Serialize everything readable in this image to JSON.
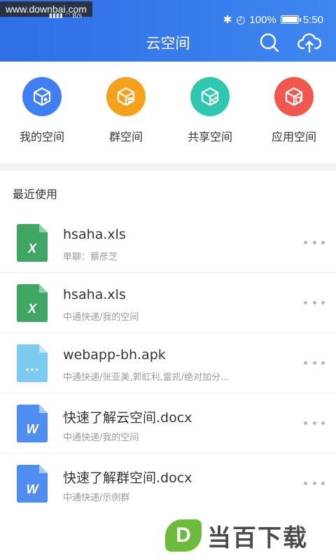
{
  "statusbar": {
    "watermark": "www.downbai.com",
    "net_speed": "B/s",
    "battery": "100%",
    "time": "5:50"
  },
  "header": {
    "title": "云空间",
    "search_icon": "search-icon",
    "upload_icon": "cloud-upload-icon"
  },
  "nav": [
    {
      "label": "我的空间",
      "icon": "my-space-icon",
      "color": "#3f7ef3"
    },
    {
      "label": "群空间",
      "icon": "group-space-icon",
      "color": "#f5a11c"
    },
    {
      "label": "共享空间",
      "icon": "shared-space-icon",
      "color": "#2ec8b0"
    },
    {
      "label": "应用空间",
      "icon": "app-space-icon",
      "color": "#f0584f"
    }
  ],
  "recent": {
    "title": "最近使用",
    "files": [
      {
        "name": "hsaha.xls",
        "meta": "单聊：蔡彦芝",
        "type": "xls",
        "glyph": "X",
        "color": "#3fa664"
      },
      {
        "name": "hsaha.xls",
        "meta": "中通快递/我的空间",
        "type": "xls",
        "glyph": "X",
        "color": "#3fa664"
      },
      {
        "name": "webapp-bh.apk",
        "meta": "中通快递/张亚美,郭虹利,雷凯/绝对加分...",
        "type": "apk",
        "glyph": "...",
        "color": "#7ccaf0"
      },
      {
        "name": "快速了解云空间.docx",
        "meta": "中通快递/我的空间",
        "type": "docx",
        "glyph": "W",
        "color": "#4f8ef0"
      },
      {
        "name": "快速了解群空间.docx",
        "meta": "中通快递/示例群",
        "type": "docx",
        "glyph": "W",
        "color": "#4f8ef0"
      }
    ]
  },
  "watermark_bottom": {
    "logo": "D",
    "text": "当百下载"
  }
}
